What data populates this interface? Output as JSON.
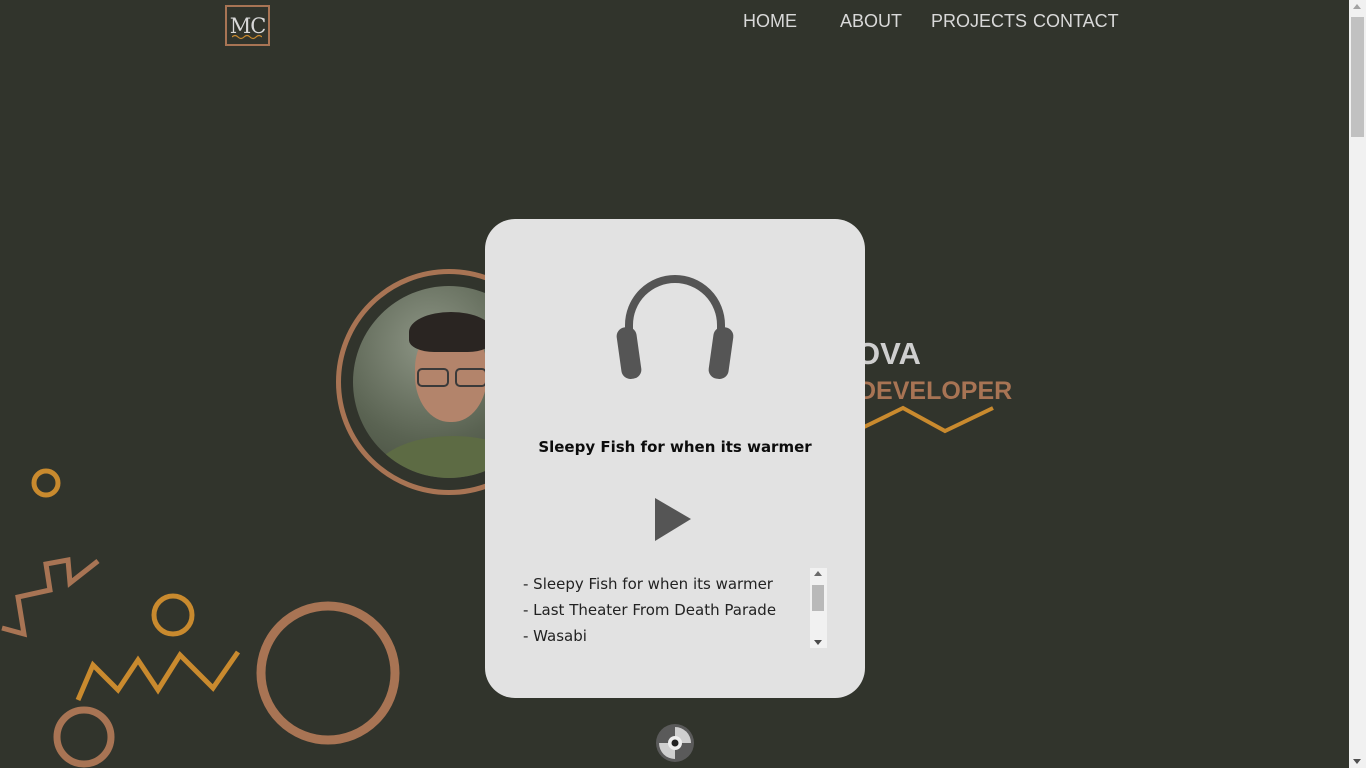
{
  "logo": {
    "text": "MC"
  },
  "nav": {
    "items": [
      {
        "label": "HOME"
      },
      {
        "label": "ABOUT"
      },
      {
        "label": "PROJECTS"
      },
      {
        "label": "CONTACT"
      }
    ]
  },
  "hero": {
    "title_visible": "OVA",
    "subtitle_visible": "DEVELOPER"
  },
  "player": {
    "current_track": "Sleepy Fish for when its warmer",
    "playlist": [
      "- Sleepy Fish for when its warmer",
      "- Last Theater From Death Parade",
      "- Wasabi"
    ]
  },
  "icons": {
    "player": "headphones-icon",
    "play": "play-icon",
    "disc": "disc-icon"
  },
  "colors": {
    "background": "#31342c",
    "accent_brown": "#a87454",
    "accent_gold": "#c98a2e",
    "card": "#e2e2e2",
    "nav_text": "#d9d9d9"
  }
}
